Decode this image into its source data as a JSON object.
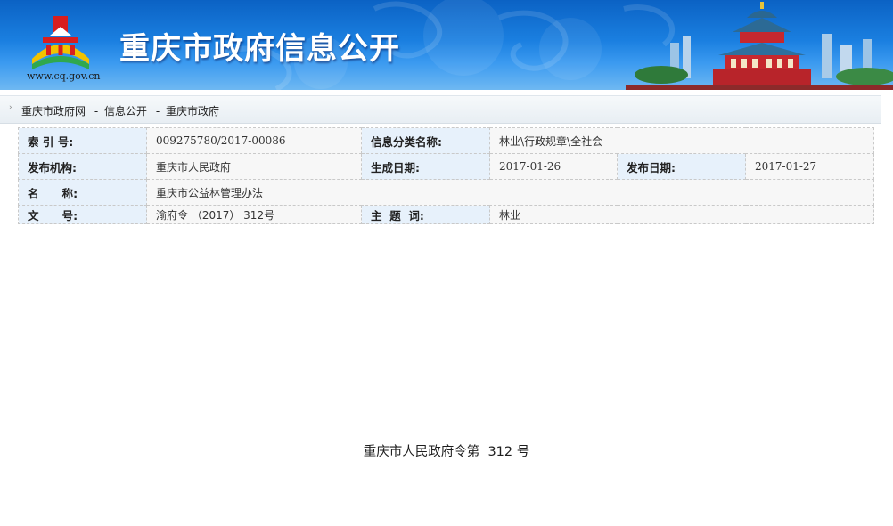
{
  "header": {
    "site_title": "重庆市政府信息公开",
    "site_url": "www.cq.gov.cn"
  },
  "breadcrumb": {
    "items": [
      "重庆市政府网",
      "信息公开",
      "重庆市政府"
    ],
    "separator": "-"
  },
  "info": {
    "index_label": "索 引 号:",
    "index_value": "009275780/2017-00086",
    "category_label": "信息分类名称:",
    "category_value": "林业\\行政规章\\全社会",
    "issuer_label": "发布机构:",
    "issuer_value": "重庆市人民政府",
    "created_label": "生成日期:",
    "created_value": "2017-01-26",
    "published_label": "发布日期:",
    "published_value": "2017-01-27",
    "name_label": "名      称:",
    "name_value": "重庆市公益林管理办法",
    "docno_label": "文      号:",
    "docno_value": "渝府令 （2017） 312号",
    "keyword_label": "主  题  词:",
    "keyword_value": "林业"
  },
  "document": {
    "decree_heading": "重庆市人民政府令第  312 号"
  },
  "colors": {
    "banner_blue": "#1a7fe0",
    "key_cell_bg": "#e7f1fb",
    "value_cell_bg": "#f7f7f7"
  }
}
